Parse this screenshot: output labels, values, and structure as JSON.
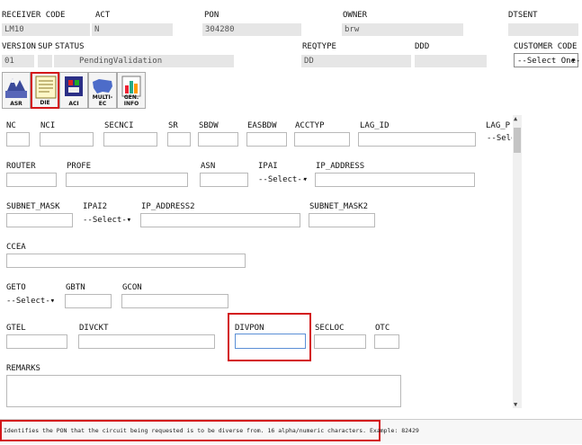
{
  "header": {
    "receiver_code_label": "RECEIVER CODE",
    "receiver_code_value": "LM10",
    "act_label": "ACT",
    "act_value": "N",
    "pon_label": "PON",
    "pon_value": "304280",
    "owner_label": "OWNER",
    "owner_value": "brw",
    "dtsent_label": "DTSENT",
    "version_label": "VERSION",
    "version_value": "01",
    "sup_label": "SUP",
    "status_label": "STATUS",
    "status_value": "PendingValidation",
    "reqtype_label": "REQTYPE",
    "reqtype_value": "DD",
    "ddd_label": "DDD",
    "customer_code_label": "CUSTOMER CODE",
    "customer_code_value": "--Select One--"
  },
  "toolbar": {
    "asr": "ASR",
    "die": "DIE",
    "aci": "ACI",
    "multi_ec": "MULTI-EC",
    "gen_info": "GEN. INFO"
  },
  "form": {
    "nc": "NC",
    "nci": "NCI",
    "secnci": "SECNCI",
    "sr": "SR",
    "sbdw": "SBDW",
    "easbdw": "EASBDW",
    "acctyp": "ACCTYP",
    "lag_id": "LAG_ID",
    "lag_p": "LAG_P",
    "lag_p_select": "--Select",
    "router": "ROUTER",
    "profe": "PROFE",
    "asn": "ASN",
    "ipai": "IPAI",
    "ipai_select": "--Select--",
    "ip_address": "IP_ADDRESS",
    "subnet_mask": "SUBNET_MASK",
    "ipai2": "IPAI2",
    "ipai2_select": "--Select--",
    "ip_address2": "IP_ADDRESS2",
    "subnet_mask2": "SUBNET_MASK2",
    "ccea": "CCEA",
    "geto": "GETO",
    "geto_select": "--Select--",
    "gbtn": "GBTN",
    "gcon": "GCON",
    "gtel": "GTEL",
    "divckt": "DIVCKT",
    "divpon": "DIVPON",
    "secloc": "SECLOC",
    "otc": "OTC",
    "remarks": "REMARKS"
  },
  "help_text": "Identifies the PON that the circuit being requested is to be diverse from. 16 alpha/numeric characters. Example: 82429",
  "colors": {
    "highlight": "#d3171a",
    "readonly_bg": "#e6e6e6"
  }
}
